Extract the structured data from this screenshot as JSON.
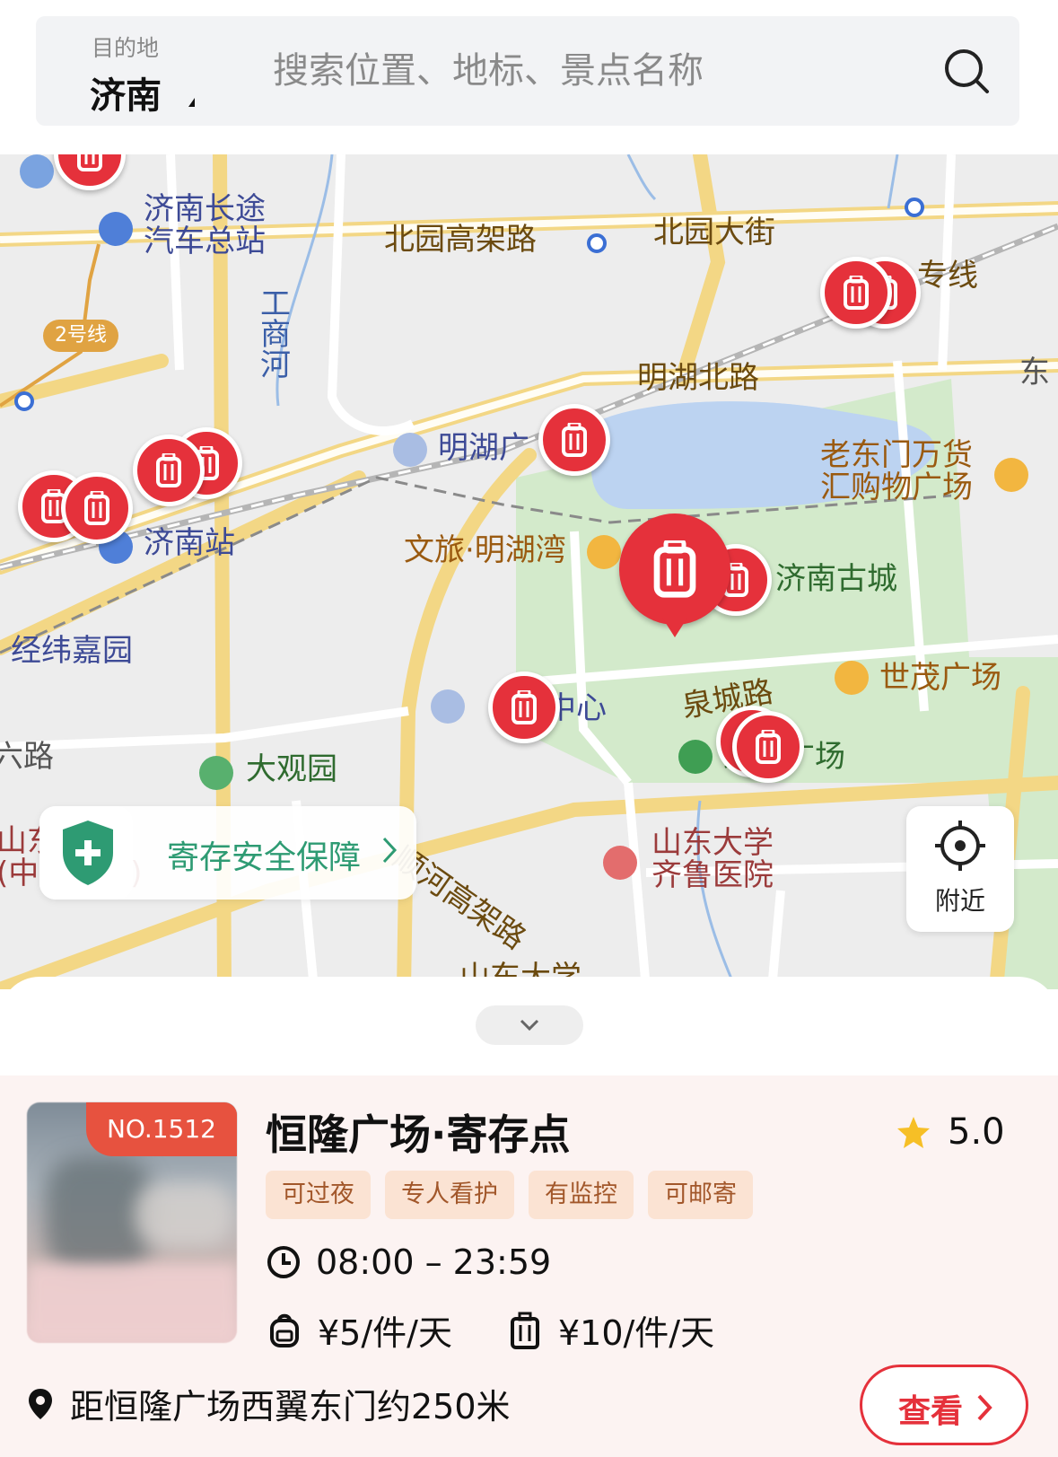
{
  "search": {
    "destination_label": "目的地",
    "city": "济南",
    "placeholder": "搜索位置、地标、景点名称"
  },
  "map": {
    "labels": {
      "bus_station": "济南长途\n汽车总站",
      "beiyuan_viaduct": "北园高架路",
      "beiyuan_street": "北园大街",
      "metro_line": "2号线",
      "gongshang_river": "工\n商\n河",
      "special_line": "专线",
      "minghu_north_road": "明湖北路",
      "east": "东",
      "minghu_square": "明湖广",
      "laodongmen_mall": "老东门万货\n汇购物广场",
      "jinan_station": "济南站",
      "wenlv_minghu_bay": "文旅·明湖湾",
      "jinan_old_city": "济南古城",
      "jingwei_garden": "经纬嘉园",
      "quancheng_road": "泉城路",
      "shimao_plaza": "世茂广场",
      "center": "中心",
      "quancheng_square": "泉城广场",
      "liu_road": "六路",
      "daguanyuan": "大观园",
      "shandong_center": "山东\n(中心院区)",
      "shunhe_viaduct": "顺河高架路",
      "qilu_hospital": "山东大学\n齐鲁医院",
      "road": "路",
      "shandong_university": "山东大学"
    },
    "safety_banner": "寄存安全保障",
    "nearby_button": "附近"
  },
  "store": {
    "rank": "NO.1512",
    "title": "恒隆广场·寄存点",
    "rating": "5.0",
    "tags": [
      "可过夜",
      "专人看护",
      "有监控",
      "可邮寄"
    ],
    "hours": "08:00 – 23:59",
    "price_small": "¥5/件/天",
    "price_large": "¥10/件/天",
    "address": "距恒隆广场西翼东门约250米",
    "view_button": "查看"
  },
  "colors": {
    "pin_red": "#e5313b",
    "tag_bg": "#fbe3d3",
    "tag_text": "#a2572a",
    "safety_green": "#2e9b73",
    "card_bg": "#fcf3f2"
  },
  "icons": [
    "search-icon",
    "luggage-icon",
    "shield-plus-icon",
    "crosshair-icon",
    "chevron-down-icon",
    "star-icon",
    "clock-icon",
    "backpack-icon",
    "suitcase-icon",
    "location-pin-icon",
    "chevron-right-icon"
  ]
}
